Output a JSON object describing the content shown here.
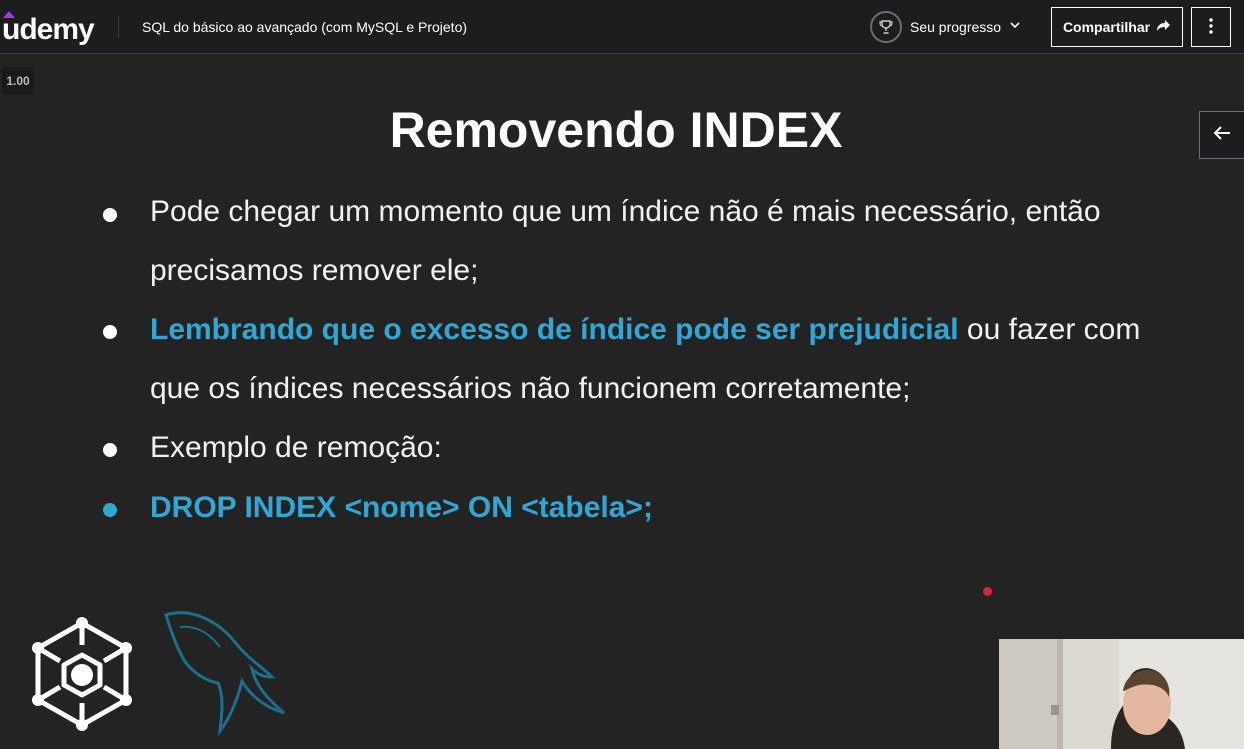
{
  "header": {
    "logo_text": "udemy",
    "course_title": "SQL do básico ao avançado (com MySQL e Projeto)",
    "progress_label": "Seu progresso",
    "share_label": "Compartilhar",
    "accent_color": "#a435f0"
  },
  "player": {
    "speed": "1.00"
  },
  "slide": {
    "title": "Removendo INDEX",
    "bullet1_line1": "Pode chegar um momento que um índice não é mais necessário, então",
    "bullet1_line2": "precisamos remover ele;",
    "bullet2_highlight": "Lembrando que o excesso de índice pode ser prejudicial",
    "bullet2_rest": " ou fazer com",
    "bullet2_line2": "que os índices necessários não funcionem corretamente;",
    "bullet3": "Exemplo de remoção:",
    "bullet4": "DROP INDEX <nome> ON <tabela>;",
    "highlight_color": "#2fa8d5"
  },
  "icons": {
    "progress": "trophy-icon",
    "share": "share-arrow-icon",
    "more": "more-vertical-icon",
    "side_panel": "arrow-left-icon",
    "logo_left": "hexagon-network-logo",
    "logo_right": "mysql-dolphin-logo"
  }
}
